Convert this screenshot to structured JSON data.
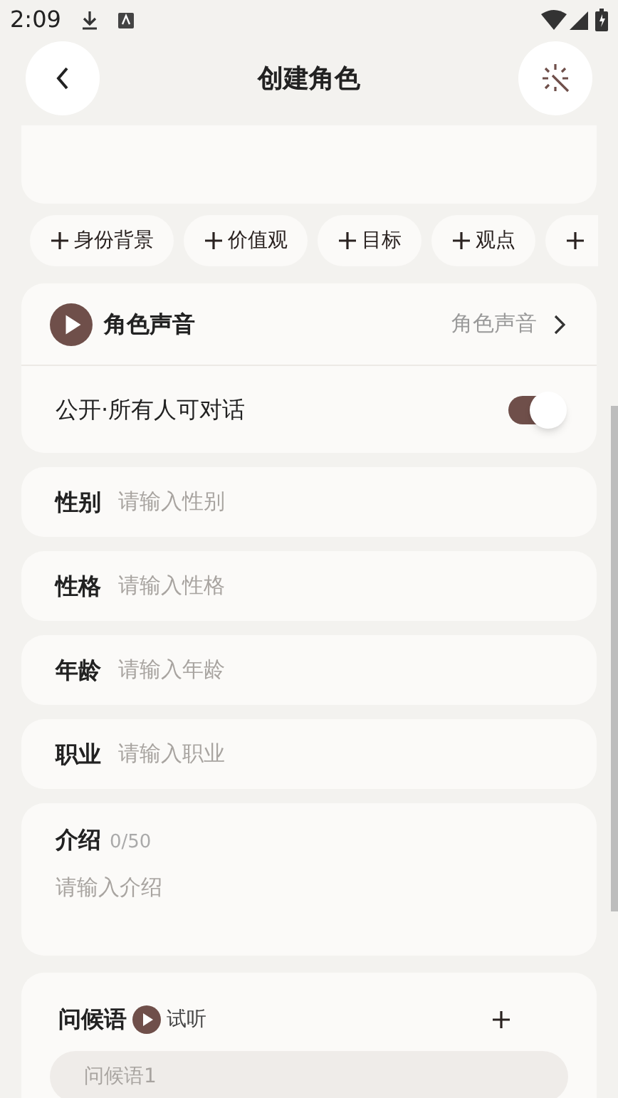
{
  "status_bar": {
    "time": "2:09"
  },
  "header": {
    "title": "创建角色"
  },
  "chips": [
    {
      "label": "身份背景"
    },
    {
      "label": "价值观"
    },
    {
      "label": "目标"
    },
    {
      "label": "观点"
    },
    {
      "kind": "cut"
    }
  ],
  "voice": {
    "label": "角色声音",
    "value": "角色声音"
  },
  "public": {
    "label": "公开·所有人可对话",
    "on": true
  },
  "fields": [
    {
      "label": "性别",
      "placeholder": "请输入性别"
    },
    {
      "label": "性格",
      "placeholder": "请输入性格"
    },
    {
      "label": "年龄",
      "placeholder": "请输入年龄"
    },
    {
      "label": "职业",
      "placeholder": "请输入职业"
    }
  ],
  "intro": {
    "label": "介绍",
    "count": "0/50",
    "placeholder": "请输入介绍"
  },
  "greeting": {
    "label": "问候语",
    "listen": "试听",
    "placeholder": "问候语1"
  }
}
